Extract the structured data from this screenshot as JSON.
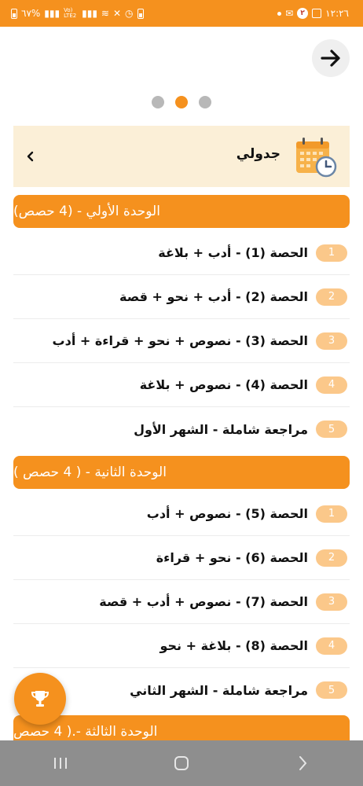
{
  "status_bar": {
    "time": "١٢:٢٦",
    "battery": "٦٧%",
    "network": "Vo) LTE2"
  },
  "schedule": {
    "label": "جدولي"
  },
  "units": [
    {
      "title": "الوحدة الأولي - (4 حصص)",
      "lessons": [
        {
          "num": "1",
          "text": "الحصة (1) - أدب + بلاغة"
        },
        {
          "num": "2",
          "text": "الحصة (2) - أدب + نحو + قصة"
        },
        {
          "num": "3",
          "text": "الحصة (3) - نصوص + نحو + قراءة + أدب"
        },
        {
          "num": "4",
          "text": "الحصة (4) - نصوص + بلاغة"
        },
        {
          "num": "5",
          "text": "مراجعة شاملة - الشهر الأول"
        }
      ]
    },
    {
      "title": "الوحدة الثانية - ( 4 حصص )",
      "lessons": [
        {
          "num": "1",
          "text": "الحصة (5) - نصوص + أدب"
        },
        {
          "num": "2",
          "text": "الحصة (6) - نحو + قراءة"
        },
        {
          "num": "3",
          "text": "الحصة (7) - نصوص + أدب + قصة"
        },
        {
          "num": "4",
          "text": "الحصة (8) - بلاغة + نحو"
        },
        {
          "num": "5",
          "text": "مراجعة شاملة - الشهر الثاني"
        }
      ]
    },
    {
      "title": "الوحدة الثالثة -.( 4 حصص ",
      "lessons": []
    }
  ],
  "colors": {
    "accent": "#f5911e",
    "badge": "#fbc88a",
    "schedule_bg": "#fbefd7"
  }
}
